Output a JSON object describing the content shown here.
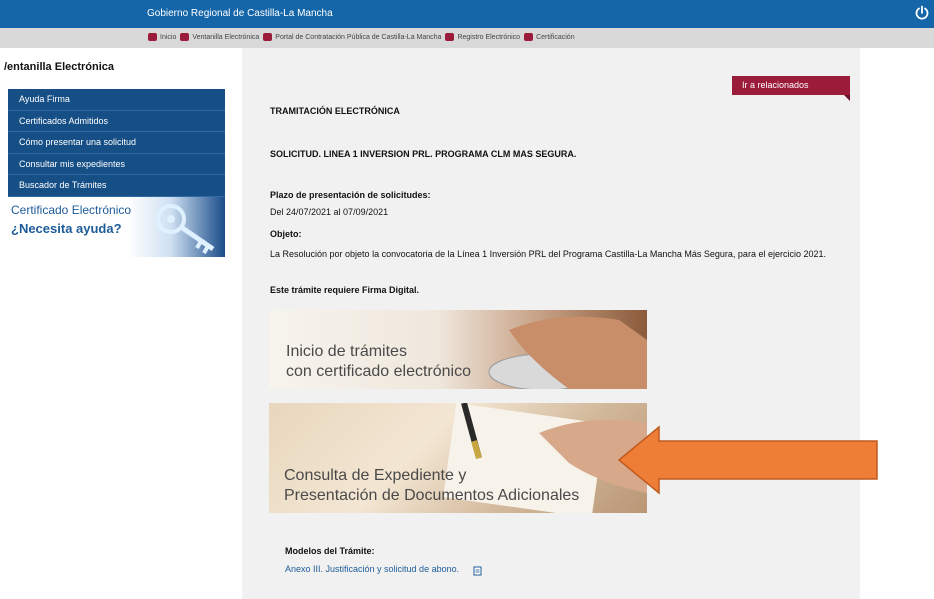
{
  "header": {
    "site_title": "Gobierno Regional de Castilla-La Mancha",
    "power_icon": "power-icon"
  },
  "nav": {
    "items": [
      {
        "label": "Inicio"
      },
      {
        "label": "Ventanilla Electrónica"
      },
      {
        "label": "Portal de Contratación Pública de Castilla-La Mancha"
      },
      {
        "label": "Registro Electrónico"
      },
      {
        "label": "Certificación"
      }
    ],
    "bullet_color": "#9b1b3a"
  },
  "sidebar": {
    "title": "/entanilla Electrónica",
    "menu": [
      {
        "label": "Ayuda Firma"
      },
      {
        "label": "Certificados Admitidos"
      },
      {
        "label": "Cómo presentar una solicitud"
      },
      {
        "label": "Consultar mis expedientes"
      },
      {
        "label": "Buscador de Trámites"
      }
    ],
    "banner": {
      "line1": "Certificado Electrónico",
      "line2": "¿Necesita ayuda?",
      "icon": "key-icon"
    }
  },
  "main": {
    "related_button": "Ir a relacionados",
    "tramitacion_title": "TRAMITACIÓN ELECTRÓNICA",
    "solicitud_title": "SOLICITUD. LINEA 1 INVERSION PRL. PROGRAMA CLM MAS SEGURA.",
    "plazo_label": "Plazo de presentación de solicitudes:",
    "plazo_value": "Del 24/07/2021 al 07/09/2021",
    "objeto_label": "Objeto:",
    "objeto_text": "La Resolución por objeto la convocatoria de la Línea 1 Inversión PRL del Programa Castilla-La Mancha Más Segura, para el ejercicio 2021.",
    "firma_text": "Este trámite requiere Firma Digital.",
    "banner_inicio": {
      "line1": "Inicio de trámites",
      "line2": "con certificado electrónico"
    },
    "banner_consulta": {
      "line1": "Consulta de Expediente y",
      "line2": "Presentación de Documentos Adicionales"
    },
    "arrow_color": "#ee7d36",
    "models_label": "Modelos del Trámite:",
    "anexo_link": "Anexo III. Justificación y solicitud de abono.",
    "anexo_icon": "document-icon"
  }
}
